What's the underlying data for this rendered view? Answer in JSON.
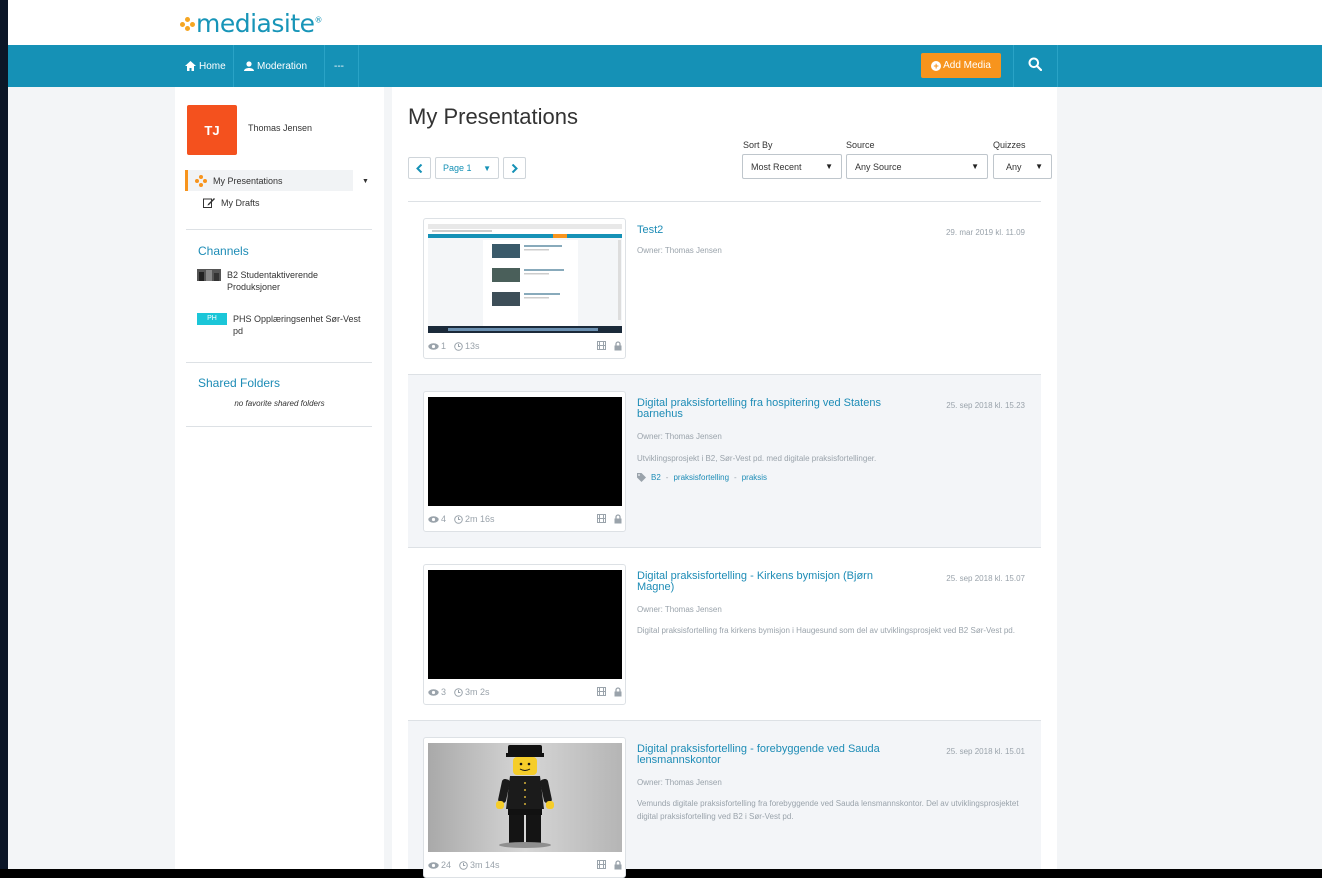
{
  "app": {
    "logo_text": "mediasite",
    "logo_mark": "®"
  },
  "nav": {
    "home": "Home",
    "moderation": "Moderation",
    "more": "---",
    "add_media": "Add Media"
  },
  "sidebar": {
    "avatar_initials": "TJ",
    "user_name": "Thomas Jensen",
    "items": [
      {
        "label": "My Presentations",
        "icon": "mediasite-dots-icon",
        "active": true
      },
      {
        "label": "My Drafts",
        "icon": "edit-icon",
        "active": false
      }
    ],
    "channels_title": "Channels",
    "channels": [
      {
        "label": "B2 Studentaktiverende Produksjoner",
        "thumb": "channel-thumbnail"
      },
      {
        "label": "PHS Opplæringsenhet Sør-Vest pd",
        "badge": "PH"
      }
    ],
    "shared_folders_title": "Shared Folders",
    "no_shared_folders": "no favorite shared folders"
  },
  "main": {
    "title": "My Presentations",
    "pager": {
      "prev": "<",
      "page": "Page 1",
      "next": ">"
    },
    "filters": {
      "sort_by": {
        "label": "Sort By",
        "value": "Most Recent"
      },
      "source": {
        "label": "Source",
        "value": "Any Source"
      },
      "quizzes": {
        "label": "Quizzes",
        "value": "Any"
      }
    },
    "presentations": [
      {
        "title": "Test2",
        "date": "29. mar 2019 kl. 11.09",
        "owner": "Owner: Thomas Jensen",
        "description": "",
        "tags": [],
        "views": "1",
        "duration": "13s",
        "thumbnail": "screenshot"
      },
      {
        "title": "Digital praksisfortelling fra hospitering ved Statens barnehus",
        "date": "25. sep 2018 kl. 15.23",
        "owner": "Owner: Thomas Jensen",
        "description": "Utviklingsprosjekt i B2, Sør-Vest pd. med digitale praksisfortellinger.",
        "tags": [
          "B2",
          "praksisfortelling",
          "praksis"
        ],
        "views": "4",
        "duration": "2m 16s",
        "thumbnail": "black"
      },
      {
        "title": "Digital praksisfortelling - Kirkens bymisjon (Bjørn Magne)",
        "date": "25. sep 2018 kl. 15.07",
        "owner": "Owner: Thomas Jensen",
        "description": "Digital praksisfortelling fra kirkens bymisjon i Haugesund som del av utviklingsprosjekt ved B2 Sør-Vest pd.",
        "tags": [],
        "views": "3",
        "duration": "3m 2s",
        "thumbnail": "black"
      },
      {
        "title": "Digital praksisfortelling - forebyggende ved Sauda lensmannskontor",
        "date": "25. sep 2018 kl. 15.01",
        "owner": "Owner: Thomas Jensen",
        "description": "Vemunds digitale praksisfortelling fra forebyggende ved Sauda lensmannskontor. Del av utviklingsprosjektet digital praksisfortelling ved B2 i Sør-Vest pd.",
        "tags": [],
        "views": "24",
        "duration": "3m 14s",
        "thumbnail": "lego-figure"
      }
    ]
  },
  "colors": {
    "brand_blue": "#1591b6",
    "accent_orange": "#f7941d",
    "avatar_red": "#f4511e",
    "badge_cyan": "#1bc6d8"
  }
}
